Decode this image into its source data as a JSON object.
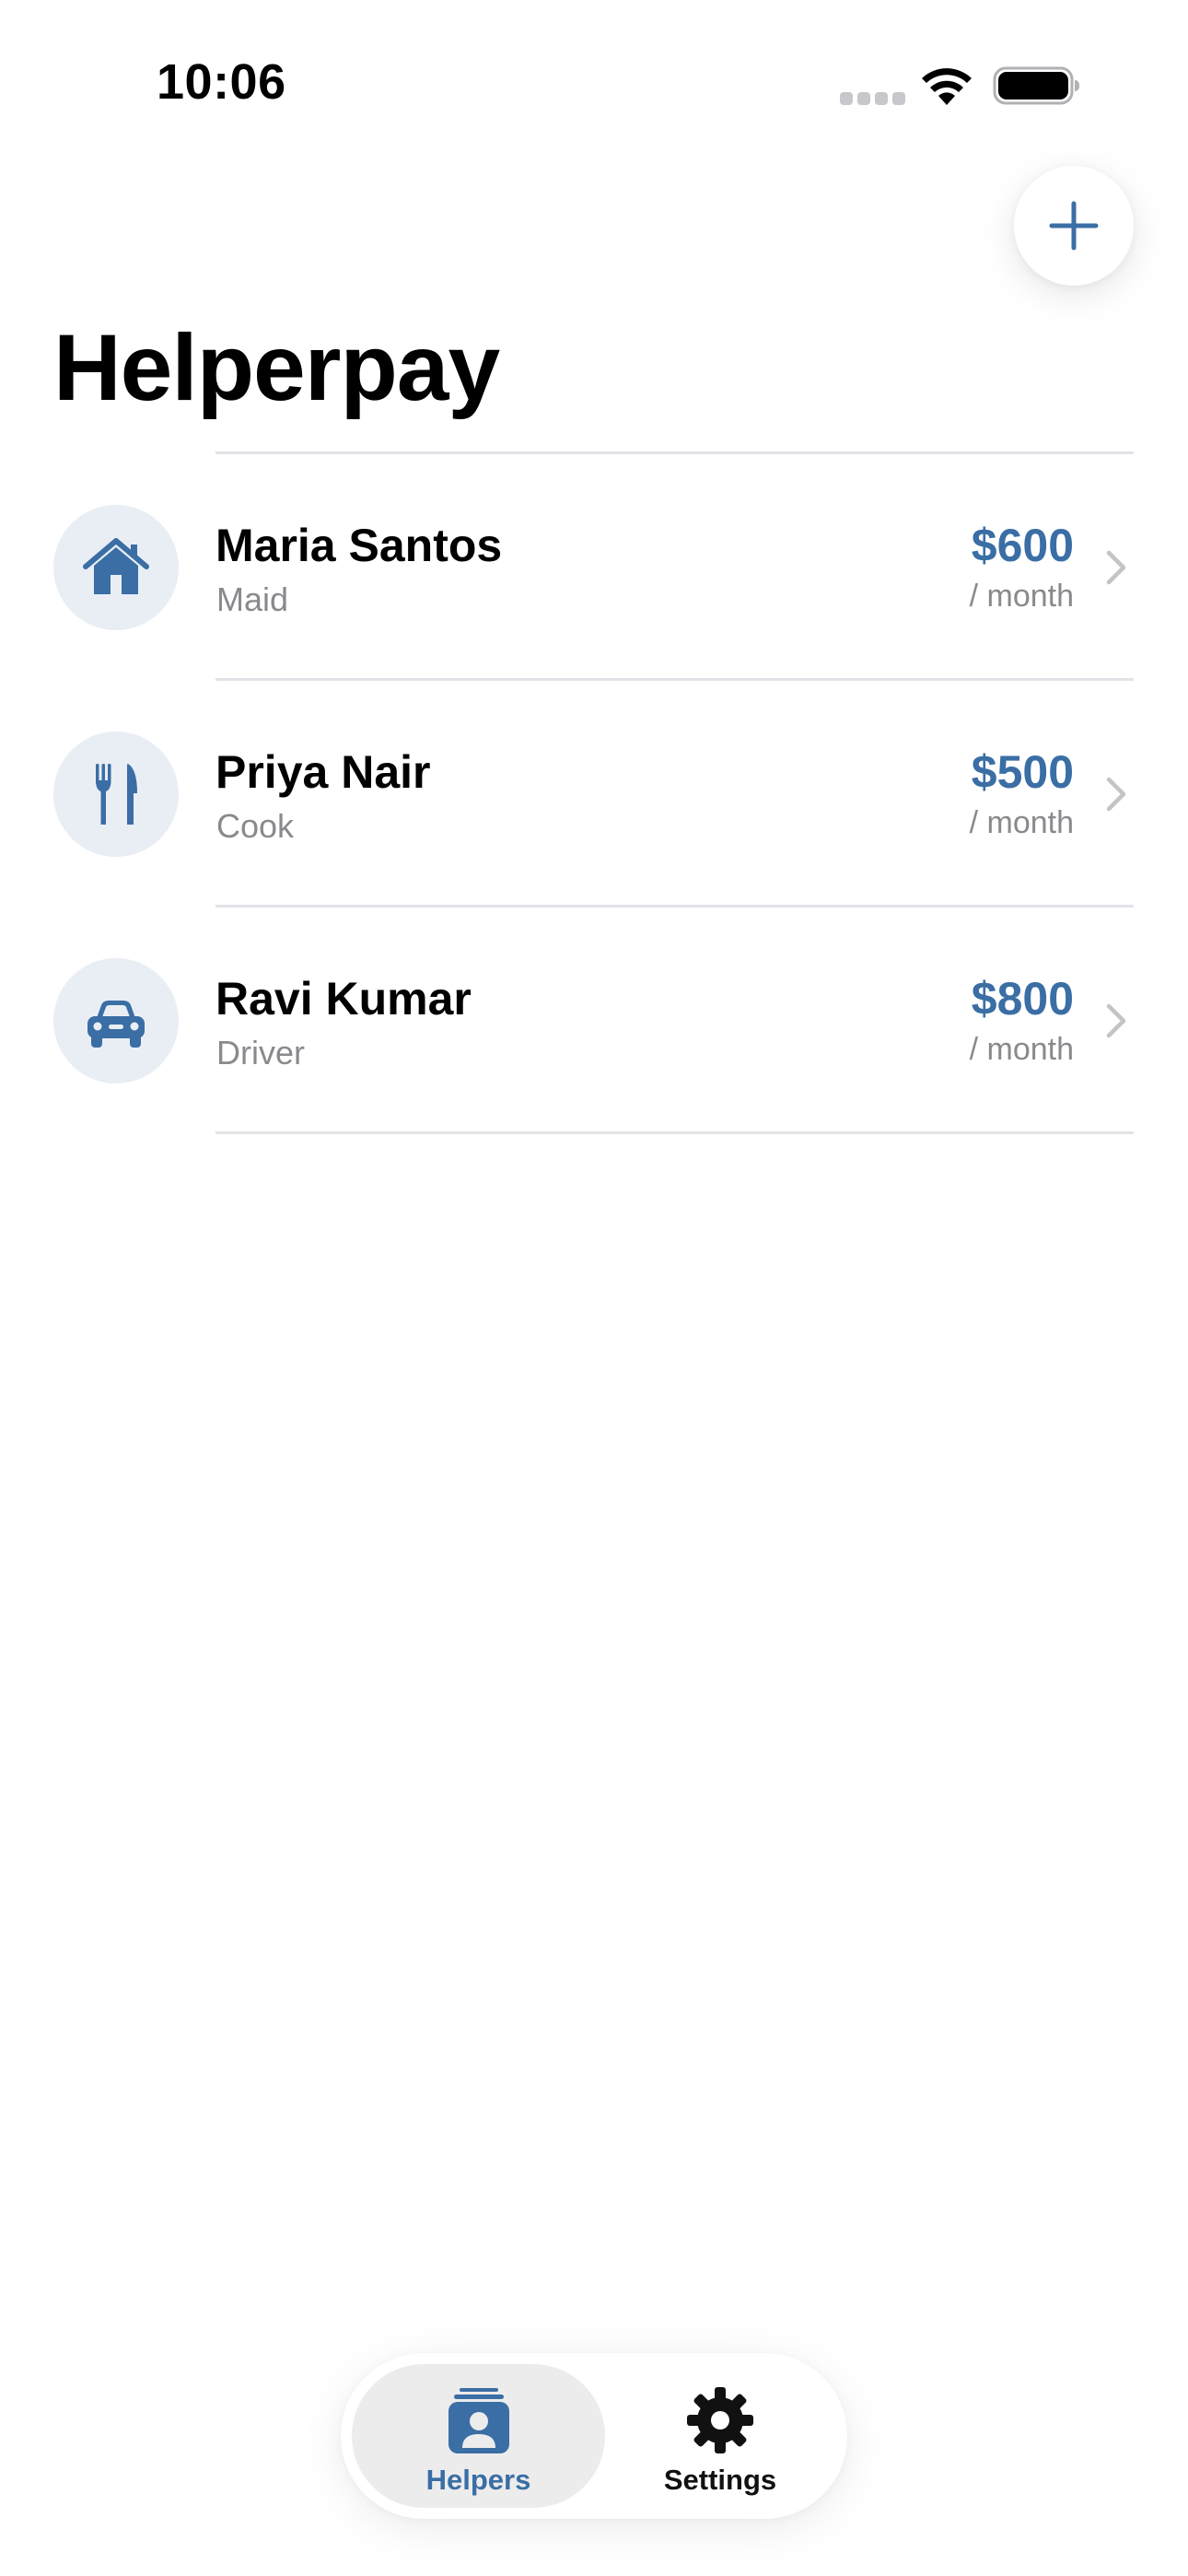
{
  "status_bar": {
    "time": "10:06"
  },
  "app": {
    "title": "Helperpay",
    "accent_color": "#3a6ea5",
    "add_icon": "plus-icon"
  },
  "helpers": [
    {
      "name": "Maria Santos",
      "role": "Maid",
      "amount": "$600",
      "period": "/ month",
      "icon": "house-icon"
    },
    {
      "name": "Priya Nair",
      "role": "Cook",
      "amount": "$500",
      "period": "/ month",
      "icon": "fork-knife-icon"
    },
    {
      "name": "Ravi Kumar",
      "role": "Driver",
      "amount": "$800",
      "period": "/ month",
      "icon": "car-icon"
    }
  ],
  "tab_bar": {
    "tabs": [
      {
        "label": "Helpers",
        "icon": "person-card-stack-icon",
        "selected": true
      },
      {
        "label": "Settings",
        "icon": "gear-icon",
        "selected": false
      }
    ]
  }
}
